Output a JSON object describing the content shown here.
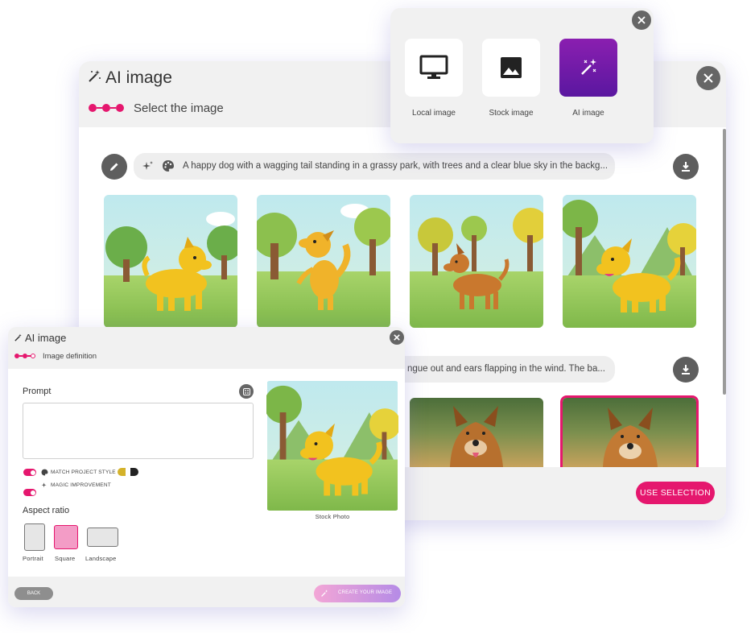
{
  "main_dialog": {
    "title": "AI image",
    "step_label": "Select the image",
    "prompt_1": "A happy dog with a wagging tail standing in a grassy park, with trees and a clear blue sky in the backg...",
    "prompt_2": "ngue out and ears flapping in the wind. The ba...",
    "use_selection": "USE SELECTION"
  },
  "picker": {
    "options": [
      {
        "label": "Local image",
        "icon": "monitor-icon"
      },
      {
        "label": "Stock image",
        "icon": "image-icon"
      },
      {
        "label": "AI image",
        "icon": "magic-wand-icon"
      }
    ],
    "active_color": "#7a1fa8"
  },
  "small_dialog": {
    "title": "AI image",
    "step_label": "Image definition",
    "prompt_label": "Prompt",
    "prompt_value": "",
    "toggle_match": "MATCH PROJECT STYLE",
    "toggle_magic": "MAGIC IMPROVEMENT",
    "aspect_label": "Aspect ratio",
    "aspects": [
      "Portrait",
      "Square",
      "Landscape"
    ],
    "selected_aspect": "Square",
    "preview_caption": "Stock Photo",
    "back": "BACK",
    "create": "CREATE YOUR IMAGE"
  },
  "colors": {
    "accent": "#e5176e",
    "header_bg": "#f1f1f1"
  }
}
